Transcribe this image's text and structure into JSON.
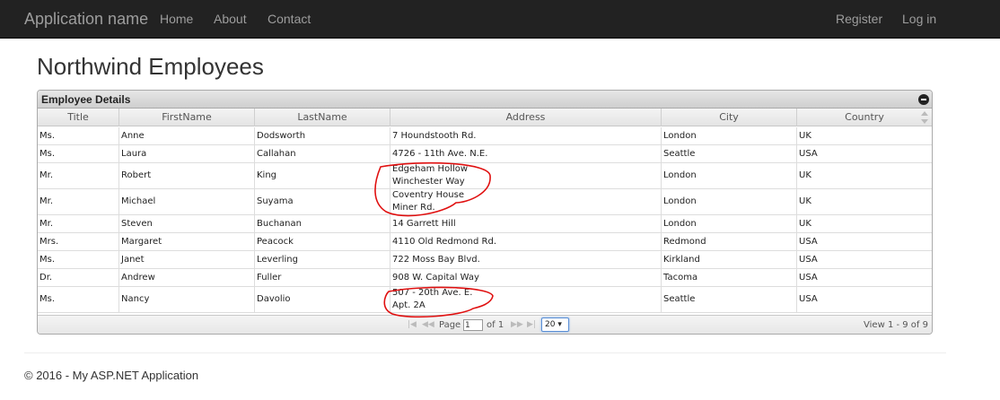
{
  "navbar": {
    "brand": "Application name",
    "left_links": [
      "Home",
      "About",
      "Contact"
    ],
    "right_links": [
      "Register",
      "Log in"
    ]
  },
  "page": {
    "title": "Northwind Employees"
  },
  "grid": {
    "caption": "Employee Details",
    "columns": [
      "Title",
      "FirstName",
      "LastName",
      "Address",
      "City",
      "Country"
    ],
    "rows": [
      [
        "Ms.",
        "Anne",
        "Dodsworth",
        "7 Houndstooth Rd.",
        "London",
        "UK"
      ],
      [
        "Ms.",
        "Laura",
        "Callahan",
        "4726 - 11th Ave. N.E.",
        "Seattle",
        "USA"
      ],
      [
        "Mr.",
        "Robert",
        "King",
        "Edgeham Hollow\nWinchester Way",
        "London",
        "UK"
      ],
      [
        "Mr.",
        "Michael",
        "Suyama",
        "Coventry House\nMiner Rd.",
        "London",
        "UK"
      ],
      [
        "Mr.",
        "Steven",
        "Buchanan",
        "14 Garrett Hill",
        "London",
        "UK"
      ],
      [
        "Mrs.",
        "Margaret",
        "Peacock",
        "4110 Old Redmond Rd.",
        "Redmond",
        "USA"
      ],
      [
        "Ms.",
        "Janet",
        "Leverling",
        "722 Moss Bay Blvd.",
        "Kirkland",
        "USA"
      ],
      [
        "Dr.",
        "Andrew",
        "Fuller",
        "908 W. Capital Way",
        "Tacoma",
        "USA"
      ],
      [
        "Ms.",
        "Nancy",
        "Davolio",
        "507 - 20th Ave. E.\nApt. 2A",
        "Seattle",
        "USA"
      ]
    ],
    "pager": {
      "page_label": "Page",
      "page_value": "1",
      "of_label": "of 1",
      "rows_per_page": "20 ▾",
      "view_text": "View 1 - 9 of 9"
    }
  },
  "footer": {
    "text": "© 2016 - My ASP.NET Application"
  },
  "icons": {
    "collapse": "collapse-icon",
    "pager": [
      "first-page-icon",
      "prev-page-icon",
      "next-page-icon",
      "last-page-icon"
    ]
  },
  "colors": {
    "navbar_bg": "#222222",
    "nav_text": "#9d9d9d",
    "annotation": "#e01010"
  }
}
